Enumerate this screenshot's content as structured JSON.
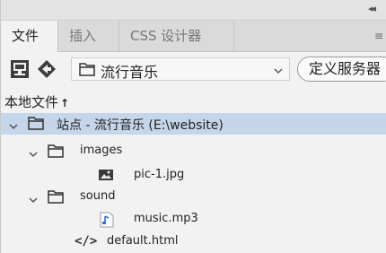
{
  "panel": {
    "collapse_glyph": "◂◂"
  },
  "tabs": [
    {
      "label": "文件",
      "active": true
    },
    {
      "label": "插入",
      "active": false
    },
    {
      "label": "CSS 设计器",
      "active": false
    }
  ],
  "tab_menu_glyph": "≡",
  "toolbar": {
    "site_name": "流行音乐",
    "define_server_label": "定义服务器"
  },
  "local_files": {
    "label": "本地文件",
    "up_arrow": "↑"
  },
  "tree": [
    {
      "label": "站点 - 流行音乐 (E:\\website)",
      "type": "site",
      "expanded": true,
      "selected": true
    },
    {
      "label": "images",
      "type": "folder",
      "expanded": true
    },
    {
      "label": "pic-1.jpg",
      "type": "image"
    },
    {
      "label": "sound",
      "type": "folder",
      "expanded": true
    },
    {
      "label": "music.mp3",
      "type": "audio"
    },
    {
      "label": "default.html",
      "type": "html"
    }
  ],
  "colors": {
    "selection": "#c5d5ea",
    "icon_gray": "#444444",
    "audio_blue": "#2a6fd6"
  }
}
